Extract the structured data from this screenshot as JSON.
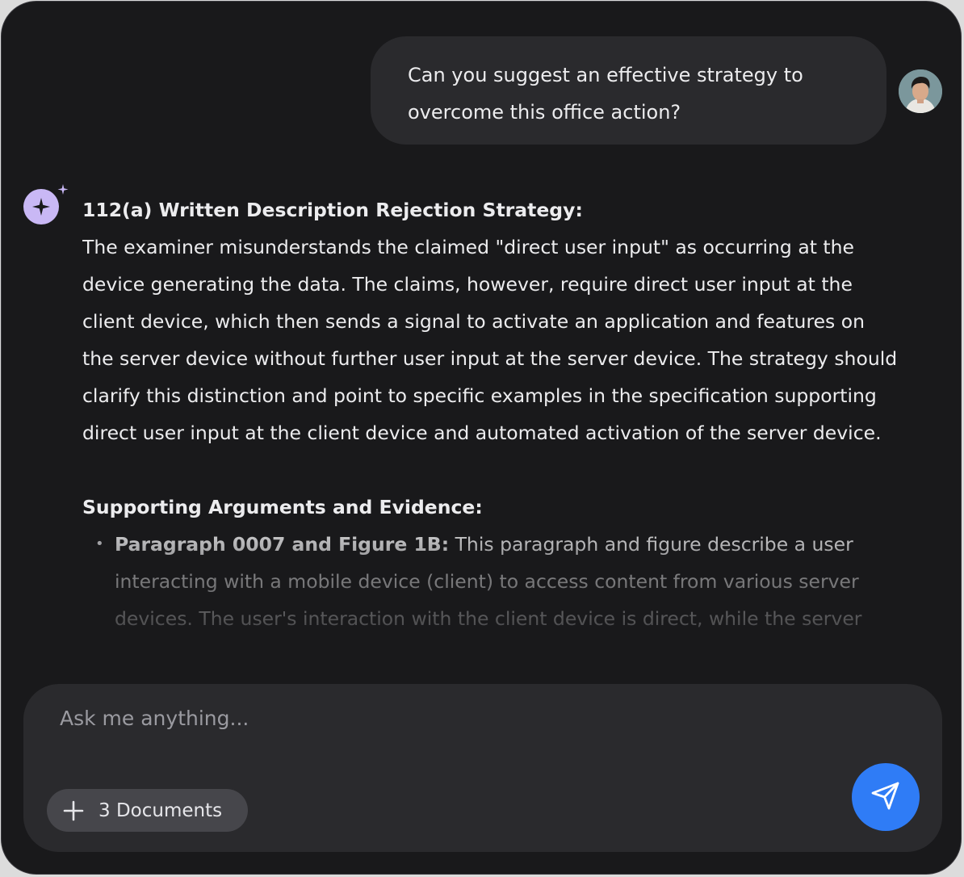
{
  "chat": {
    "user_message": "Can you suggest an effective strategy to overcome this office action?",
    "assistant": {
      "heading": "112(a) Written Description Rejection Strategy:",
      "paragraph": "The examiner misunderstands the claimed \"direct user input\" as occurring at the device generating the data. The claims, however, require direct user input at the client device, which then sends a signal to activate an application and features on the server device without further user input at the server device. The strategy should clarify this distinction and point to specific examples in the specification supporting direct user input at the client device and automated activation of the server device.",
      "subheading": "Supporting Arguments and Evidence:",
      "bullets": [
        {
          "label": "Paragraph 0007 and Figure 1B:",
          "text": " This paragraph and figure describe a user interacting with a mobile device (client) to access content from various server devices. The user's interaction with the client device is direct, while the server"
        }
      ]
    }
  },
  "composer": {
    "placeholder": "Ask me anything...",
    "docs_label": "3 Documents"
  },
  "icons": {
    "avatar": "user-avatar",
    "assistant": "sparkle-icon",
    "add": "plus-icon",
    "send": "send-icon"
  },
  "colors": {
    "background": "#19191b",
    "surface": "#2a2a2d",
    "accent": "#2f7cf6",
    "assistant_icon": "#c9b8f5"
  }
}
